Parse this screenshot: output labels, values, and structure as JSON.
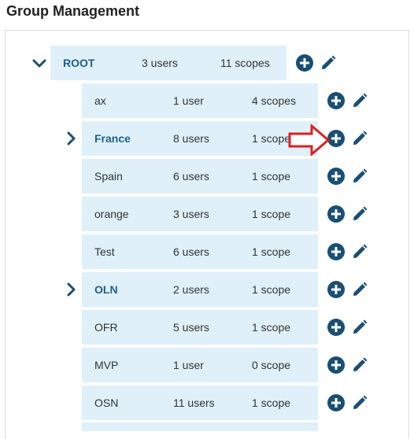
{
  "page": {
    "title": "Group Management"
  },
  "icons": {
    "add": "plus-circle-icon",
    "edit": "pencil-icon",
    "expand": "chevron-right-icon",
    "collapse": "chevron-down-icon",
    "annotation": "red-arrow-icon"
  },
  "colors": {
    "accent": "#1a4f74",
    "row_bg": "#dff0f9",
    "link": "#1f5f8c",
    "annotation": "#e02020"
  },
  "tree": {
    "root": {
      "name": "ROOT",
      "users": "3 users",
      "scopes": "11 scopes",
      "expanded": true
    },
    "children": [
      {
        "name": "ax",
        "users": "1 user",
        "scopes": "4 scopes",
        "expandable": false
      },
      {
        "name": "France",
        "users": "8 users",
        "scopes": "1 scope",
        "expandable": true
      },
      {
        "name": "Spain",
        "users": "6 users",
        "scopes": "1 scope",
        "expandable": false
      },
      {
        "name": "orange",
        "users": "3 users",
        "scopes": "1 scope",
        "expandable": false
      },
      {
        "name": "Test",
        "users": "6 users",
        "scopes": "1 scope",
        "expandable": false
      },
      {
        "name": "OLN",
        "users": "2 users",
        "scopes": "1 scope",
        "expandable": true
      },
      {
        "name": "OFR",
        "users": "5 users",
        "scopes": "1 scope",
        "expandable": false
      },
      {
        "name": "MVP",
        "users": "1 user",
        "scopes": "0 scope",
        "expandable": false
      },
      {
        "name": "OSN",
        "users": "11 users",
        "scopes": "1 scope",
        "expandable": false
      }
    ]
  }
}
